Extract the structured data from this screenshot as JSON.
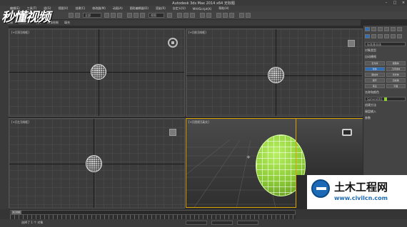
{
  "window": {
    "title": "Autodesk 3ds Max  2014 x64    无标题"
  },
  "logo_text": "秒懂视频",
  "menu": [
    "编辑(E)",
    "工具(T)",
    "组(G)",
    "视图(V)",
    "创建(C)",
    "修改器(M)",
    "动画(A)",
    "图形编辑器(D)",
    "渲染(R)",
    "自定义(U)",
    "MAXScript(X)",
    "帮助(H)"
  ],
  "toolbar": {
    "filter_select": "全部",
    "view_select": "视图"
  },
  "ribbon": [
    "建模",
    "自由形式",
    "选择",
    "对象绘制",
    "填充"
  ],
  "viewports": {
    "top": "[+][顶][线框]",
    "front": "[+][前][线框]",
    "left": "[+][左][线框]",
    "perspective": "[+][透视][真实]"
  },
  "command_panel": {
    "search_placeholder": "标准基本体",
    "object_type": "对象类型",
    "autogrid": "自动栅格",
    "objects": [
      "长方体",
      "圆锥体",
      "球体",
      "几何球体",
      "圆柱体",
      "管状体",
      "圆环",
      "四棱锥",
      "茶壶",
      "平面"
    ],
    "selected_object": "球体",
    "name_color": "名称和颜色",
    "object_name": "Sphere001",
    "object_color": "#8ccc36",
    "creation_method": "创建方法",
    "keyboard_entry": "键盘输入",
    "parameters": "参数"
  },
  "timeline": {
    "frame": "0 / 100"
  },
  "status": {
    "text": "选择了 1 个 对象"
  },
  "watermark": {
    "title": "土木工程网",
    "url": "www.civilcn.com"
  }
}
